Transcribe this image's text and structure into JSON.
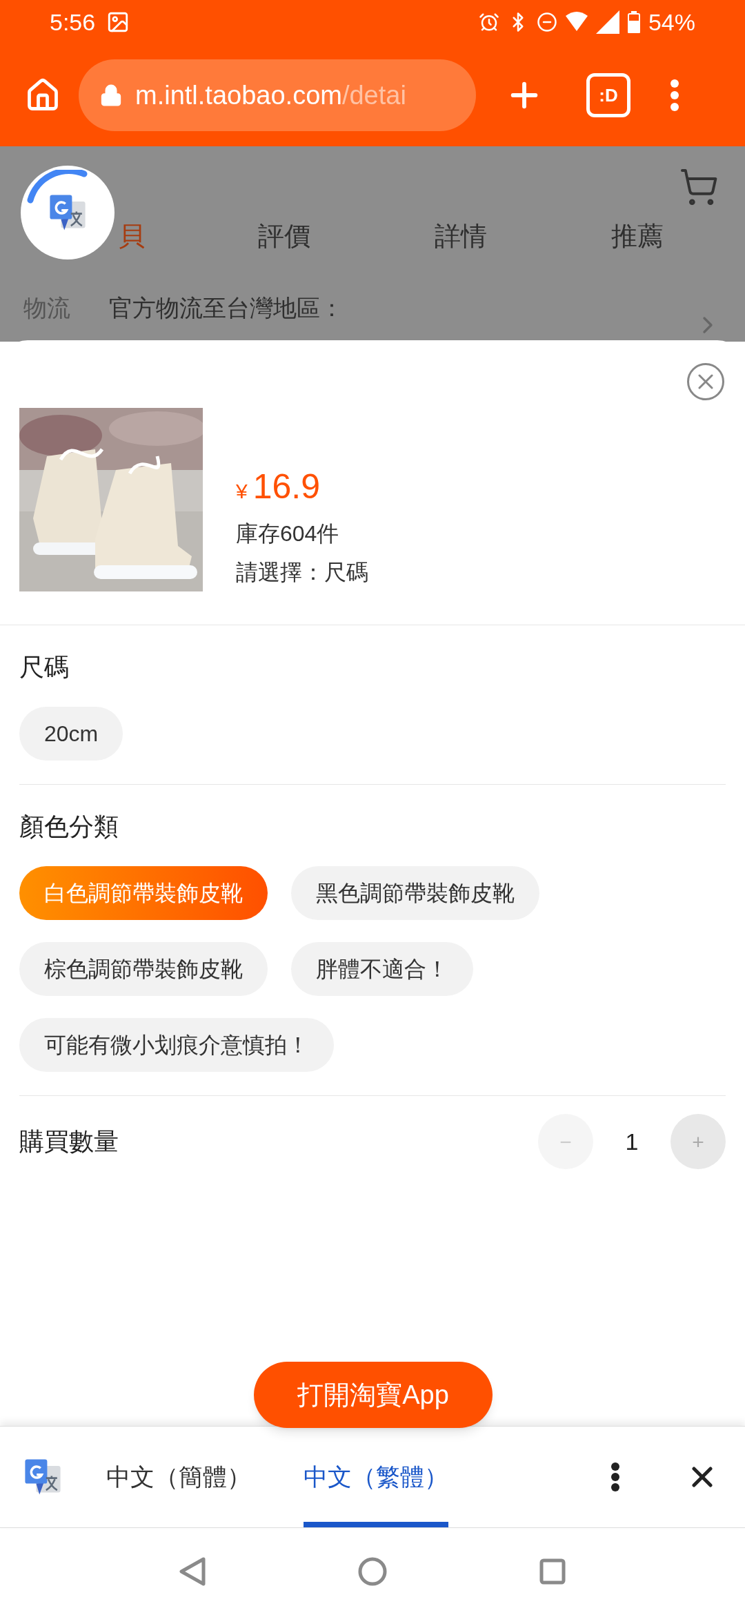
{
  "status_bar": {
    "time": "5:56",
    "battery": "54%"
  },
  "browser": {
    "url_host": "m.intl.taobao.com",
    "url_path": "/detai",
    "tab_switcher": ":D"
  },
  "page": {
    "tabs": [
      {
        "label": "貝",
        "selected": true
      },
      {
        "label": "評價",
        "selected": false
      },
      {
        "label": "詳情",
        "selected": false
      },
      {
        "label": "推薦",
        "selected": false
      }
    ],
    "logistics_label": "物流",
    "logistics_text": "官方物流至台灣地區："
  },
  "sheet": {
    "currency": "¥",
    "price": "16.9",
    "stock": "庫存604件",
    "prompt": "請選擇：尺碼",
    "groups": [
      {
        "title": "尺碼",
        "options": [
          {
            "label": "20cm",
            "selected": false
          }
        ]
      },
      {
        "title": "顏色分類",
        "options": [
          {
            "label": "白色調節帶裝飾皮靴",
            "selected": true
          },
          {
            "label": "黑色調節帶裝飾皮靴",
            "selected": false
          },
          {
            "label": "棕色調節帶裝飾皮靴",
            "selected": false
          },
          {
            "label": "胖體不適合！",
            "selected": false
          },
          {
            "label": "可能有微小划痕介意慎拍！",
            "selected": false
          }
        ]
      }
    ],
    "quantity_label": "購買數量",
    "quantity": "1",
    "minus": "−",
    "plus": "+",
    "minus_disabled": true
  },
  "open_app_button": "打開淘寶App",
  "translate_bar": {
    "languages": [
      {
        "label": "中文（簡體）",
        "selected": false
      },
      {
        "label": "中文（繁體）",
        "selected": true
      }
    ]
  }
}
